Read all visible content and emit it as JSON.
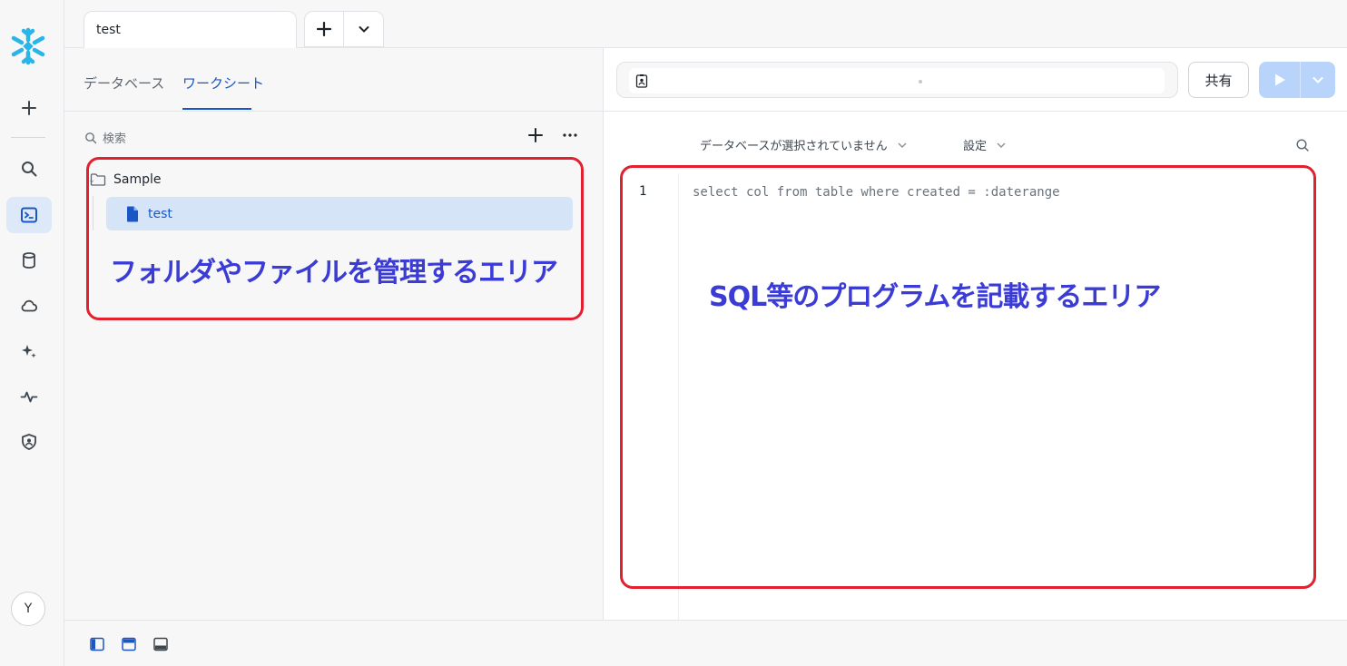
{
  "app": {
    "avatar_initial": "Y"
  },
  "tabs": {
    "worksheet_tab": "test",
    "add_icon": "plus-icon",
    "menu_icon": "chevron-down-icon"
  },
  "left_panel": {
    "tabs": [
      {
        "label": "データベース",
        "active": false
      },
      {
        "label": "ワークシート",
        "active": true
      }
    ],
    "search_placeholder": "検索",
    "tree": {
      "folder": "Sample",
      "file": "test"
    },
    "annotation": "フォルダやファイルを管理するエリア"
  },
  "toolbar": {
    "share_label": "共有"
  },
  "editor": {
    "database_select": "データベースが選択されていません",
    "settings_label": "設定",
    "line_number": "1",
    "code_line": "select col from table where created = :daterange",
    "annotation": "SQL等のプログラムを記載するエリア"
  },
  "colors": {
    "accent": "#1a56c4",
    "annotation_border": "#e3202f",
    "annotation_text": "#3b3bd6",
    "run_button": "#b9d4fa"
  }
}
